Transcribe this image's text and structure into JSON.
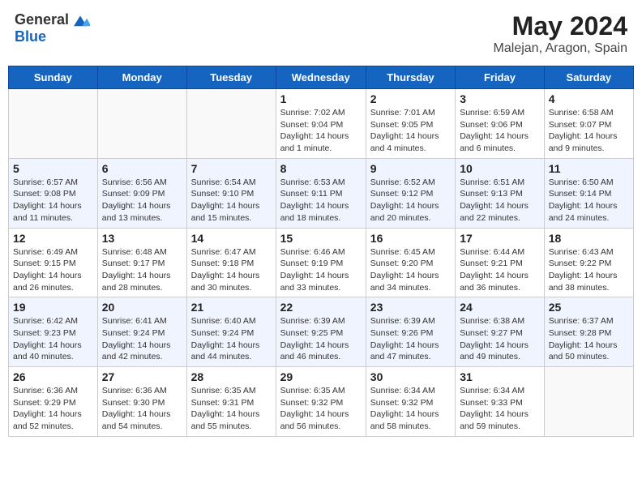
{
  "header": {
    "logo_general": "General",
    "logo_blue": "Blue",
    "title": "May 2024",
    "subtitle": "Malejan, Aragon, Spain"
  },
  "days_of_week": [
    "Sunday",
    "Monday",
    "Tuesday",
    "Wednesday",
    "Thursday",
    "Friday",
    "Saturday"
  ],
  "weeks": [
    [
      {
        "day": "",
        "info": ""
      },
      {
        "day": "",
        "info": ""
      },
      {
        "day": "",
        "info": ""
      },
      {
        "day": "1",
        "info": "Sunrise: 7:02 AM\nSunset: 9:04 PM\nDaylight: 14 hours\nand 1 minute."
      },
      {
        "day": "2",
        "info": "Sunrise: 7:01 AM\nSunset: 9:05 PM\nDaylight: 14 hours\nand 4 minutes."
      },
      {
        "day": "3",
        "info": "Sunrise: 6:59 AM\nSunset: 9:06 PM\nDaylight: 14 hours\nand 6 minutes."
      },
      {
        "day": "4",
        "info": "Sunrise: 6:58 AM\nSunset: 9:07 PM\nDaylight: 14 hours\nand 9 minutes."
      }
    ],
    [
      {
        "day": "5",
        "info": "Sunrise: 6:57 AM\nSunset: 9:08 PM\nDaylight: 14 hours\nand 11 minutes."
      },
      {
        "day": "6",
        "info": "Sunrise: 6:56 AM\nSunset: 9:09 PM\nDaylight: 14 hours\nand 13 minutes."
      },
      {
        "day": "7",
        "info": "Sunrise: 6:54 AM\nSunset: 9:10 PM\nDaylight: 14 hours\nand 15 minutes."
      },
      {
        "day": "8",
        "info": "Sunrise: 6:53 AM\nSunset: 9:11 PM\nDaylight: 14 hours\nand 18 minutes."
      },
      {
        "day": "9",
        "info": "Sunrise: 6:52 AM\nSunset: 9:12 PM\nDaylight: 14 hours\nand 20 minutes."
      },
      {
        "day": "10",
        "info": "Sunrise: 6:51 AM\nSunset: 9:13 PM\nDaylight: 14 hours\nand 22 minutes."
      },
      {
        "day": "11",
        "info": "Sunrise: 6:50 AM\nSunset: 9:14 PM\nDaylight: 14 hours\nand 24 minutes."
      }
    ],
    [
      {
        "day": "12",
        "info": "Sunrise: 6:49 AM\nSunset: 9:15 PM\nDaylight: 14 hours\nand 26 minutes."
      },
      {
        "day": "13",
        "info": "Sunrise: 6:48 AM\nSunset: 9:17 PM\nDaylight: 14 hours\nand 28 minutes."
      },
      {
        "day": "14",
        "info": "Sunrise: 6:47 AM\nSunset: 9:18 PM\nDaylight: 14 hours\nand 30 minutes."
      },
      {
        "day": "15",
        "info": "Sunrise: 6:46 AM\nSunset: 9:19 PM\nDaylight: 14 hours\nand 33 minutes."
      },
      {
        "day": "16",
        "info": "Sunrise: 6:45 AM\nSunset: 9:20 PM\nDaylight: 14 hours\nand 34 minutes."
      },
      {
        "day": "17",
        "info": "Sunrise: 6:44 AM\nSunset: 9:21 PM\nDaylight: 14 hours\nand 36 minutes."
      },
      {
        "day": "18",
        "info": "Sunrise: 6:43 AM\nSunset: 9:22 PM\nDaylight: 14 hours\nand 38 minutes."
      }
    ],
    [
      {
        "day": "19",
        "info": "Sunrise: 6:42 AM\nSunset: 9:23 PM\nDaylight: 14 hours\nand 40 minutes."
      },
      {
        "day": "20",
        "info": "Sunrise: 6:41 AM\nSunset: 9:24 PM\nDaylight: 14 hours\nand 42 minutes."
      },
      {
        "day": "21",
        "info": "Sunrise: 6:40 AM\nSunset: 9:24 PM\nDaylight: 14 hours\nand 44 minutes."
      },
      {
        "day": "22",
        "info": "Sunrise: 6:39 AM\nSunset: 9:25 PM\nDaylight: 14 hours\nand 46 minutes."
      },
      {
        "day": "23",
        "info": "Sunrise: 6:39 AM\nSunset: 9:26 PM\nDaylight: 14 hours\nand 47 minutes."
      },
      {
        "day": "24",
        "info": "Sunrise: 6:38 AM\nSunset: 9:27 PM\nDaylight: 14 hours\nand 49 minutes."
      },
      {
        "day": "25",
        "info": "Sunrise: 6:37 AM\nSunset: 9:28 PM\nDaylight: 14 hours\nand 50 minutes."
      }
    ],
    [
      {
        "day": "26",
        "info": "Sunrise: 6:36 AM\nSunset: 9:29 PM\nDaylight: 14 hours\nand 52 minutes."
      },
      {
        "day": "27",
        "info": "Sunrise: 6:36 AM\nSunset: 9:30 PM\nDaylight: 14 hours\nand 54 minutes."
      },
      {
        "day": "28",
        "info": "Sunrise: 6:35 AM\nSunset: 9:31 PM\nDaylight: 14 hours\nand 55 minutes."
      },
      {
        "day": "29",
        "info": "Sunrise: 6:35 AM\nSunset: 9:32 PM\nDaylight: 14 hours\nand 56 minutes."
      },
      {
        "day": "30",
        "info": "Sunrise: 6:34 AM\nSunset: 9:32 PM\nDaylight: 14 hours\nand 58 minutes."
      },
      {
        "day": "31",
        "info": "Sunrise: 6:34 AM\nSunset: 9:33 PM\nDaylight: 14 hours\nand 59 minutes."
      },
      {
        "day": "",
        "info": ""
      }
    ]
  ]
}
